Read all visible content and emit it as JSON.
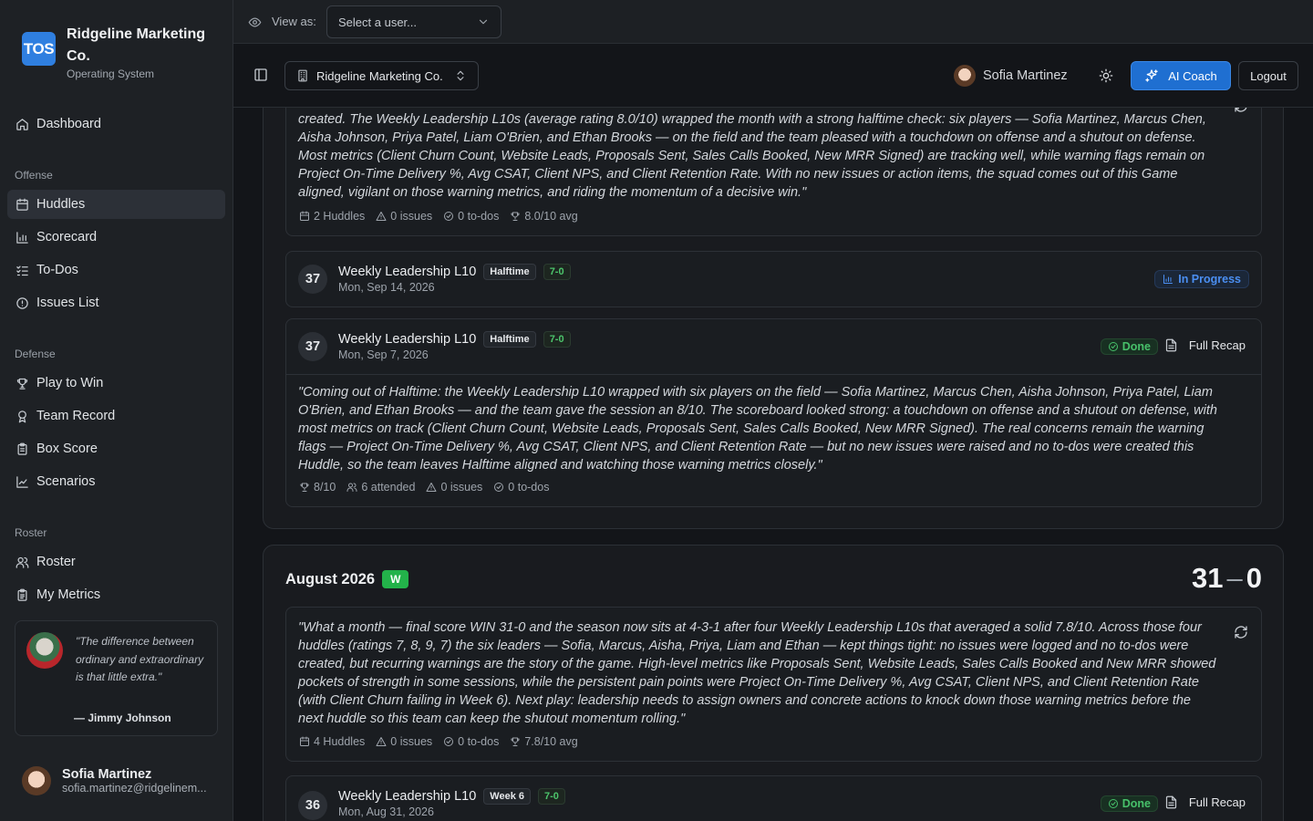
{
  "brand": {
    "logo_text": "TOS",
    "title": "Ridgeline Marketing Co.",
    "subtitle": "Operating System"
  },
  "nav": {
    "dashboard": "Dashboard",
    "sections": {
      "offense": "Offense",
      "defense": "Defense",
      "roster": "Roster"
    },
    "offense": [
      {
        "label": "Huddles",
        "icon": "calendar-icon"
      },
      {
        "label": "Scorecard",
        "icon": "bar-chart-icon"
      },
      {
        "label": "To-Dos",
        "icon": "list-checks-icon"
      },
      {
        "label": "Issues List",
        "icon": "alert-circle-icon"
      }
    ],
    "defense": [
      {
        "label": "Play to Win",
        "icon": "trophy-icon"
      },
      {
        "label": "Team Record",
        "icon": "award-icon"
      },
      {
        "label": "Box Score",
        "icon": "clipboard-icon"
      },
      {
        "label": "Scenarios",
        "icon": "line-chart-icon"
      }
    ],
    "roster": [
      {
        "label": "Roster",
        "icon": "users-icon"
      },
      {
        "label": "My Metrics",
        "icon": "clipboard-list-icon"
      }
    ],
    "active": "Huddles"
  },
  "quote": {
    "text": "\"The difference between ordinary and extraordinary is that little extra.\"",
    "author": "— Jimmy Johnson"
  },
  "user": {
    "name": "Sofia Martinez",
    "email": "sofia.martinez@ridgelinem..."
  },
  "viewbar": {
    "label": "View as:",
    "select_placeholder": "Select a user..."
  },
  "header": {
    "org": "Ridgeline Marketing Co.",
    "user_name": "Sofia Martinez",
    "coach_label": "AI Coach",
    "logout_label": "Logout"
  },
  "september": {
    "recap": "created. The Weekly Leadership L10s (average rating 8.0/10) wrapped the month with a strong halftime check: six players — Sofia Martinez, Marcus Chen, Aisha Johnson, Priya Patel, Liam O'Brien, and Ethan Brooks — on the field and the team pleased with a touchdown on offense and a shutout on defense. Most metrics (Client Churn Count, Website Leads, Proposals Sent, Sales Calls Booked, New MRR Signed) are tracking well, while warning flags remain on Project On-Time Delivery %, Avg CSAT, Client NPS, and Client Retention Rate. With no new issues or action items, the squad comes out of this Game aligned, vigilant on those warning metrics, and riding the momentum of a decisive win.\"",
    "stats": {
      "huddles": "2 Huddles",
      "issues": "0 issues",
      "todos": "0 to-dos",
      "avg": "8.0/10 avg"
    },
    "huddles": [
      {
        "week": "37",
        "name": "Weekly Leadership L10",
        "tag": "Halftime",
        "score": "7-0",
        "date": "Mon, Sep 14, 2026",
        "status": "In Progress"
      },
      {
        "week": "37",
        "name": "Weekly Leadership L10",
        "tag": "Halftime",
        "score": "7-0",
        "date": "Mon, Sep 7, 2026",
        "status": "Done",
        "recap_label": "Full Recap",
        "summary": "\"Coming out of Halftime: the Weekly Leadership L10 wrapped with six players on the field — Sofia Martinez, Marcus Chen, Aisha Johnson, Priya Patel, Liam O'Brien, and Ethan Brooks — and the team gave the session an 8/10. The scoreboard looked strong: a touchdown on offense and a shutout on defense, with most metrics on track (Client Churn Count, Website Leads, Proposals Sent, Sales Calls Booked, New MRR Signed). The real concerns remain the warning flags — Project On-Time Delivery %, Avg CSAT, Client NPS, and Client Retention Rate — but no new issues were raised and no to-dos were created this Huddle, so the team leaves Halftime aligned and watching those warning metrics closely.\"",
        "stats": {
          "rating": "8/10",
          "attended": "6 attended",
          "issues": "0 issues",
          "todos": "0 to-dos"
        }
      }
    ]
  },
  "august": {
    "name": "August 2026",
    "result": "W",
    "score_for": "31",
    "score_dash": "–",
    "score_against": "0",
    "recap": "\"What a month — final score WIN 31-0 and the season now sits at 4-3-1 after four Weekly Leadership L10s that averaged a solid 7.8/10. Across those four huddles (ratings 7, 8, 9, 7) the six leaders — Sofia, Marcus, Aisha, Priya, Liam and Ethan — kept things tight: no issues were logged and no to-dos were created, but recurring warnings are the story of the game. High-level metrics like Proposals Sent, Website Leads, Sales Calls Booked and New MRR showed pockets of strength in some sessions, while the persistent pain points were Project On-Time Delivery %, Avg CSAT, Client NPS, and Client Retention Rate (with Client Churn failing in Week 6). Next play: leadership needs to assign owners and concrete actions to knock down those warning metrics before the next huddle so this team can keep the shutout momentum rolling.\"",
    "stats": {
      "huddles": "4 Huddles",
      "issues": "0 issues",
      "todos": "0 to-dos",
      "avg": "7.8/10 avg"
    },
    "huddles": [
      {
        "week": "36",
        "name": "Weekly Leadership L10",
        "tag": "Week 6",
        "score": "7-0",
        "date": "Mon, Aug 31, 2026",
        "status": "Done",
        "recap_label": "Full Recap"
      }
    ]
  },
  "colors": {
    "accent": "#1f6fd1",
    "done": "#47c06a",
    "in_progress": "#4b8ff2",
    "win": "#23b24a"
  }
}
